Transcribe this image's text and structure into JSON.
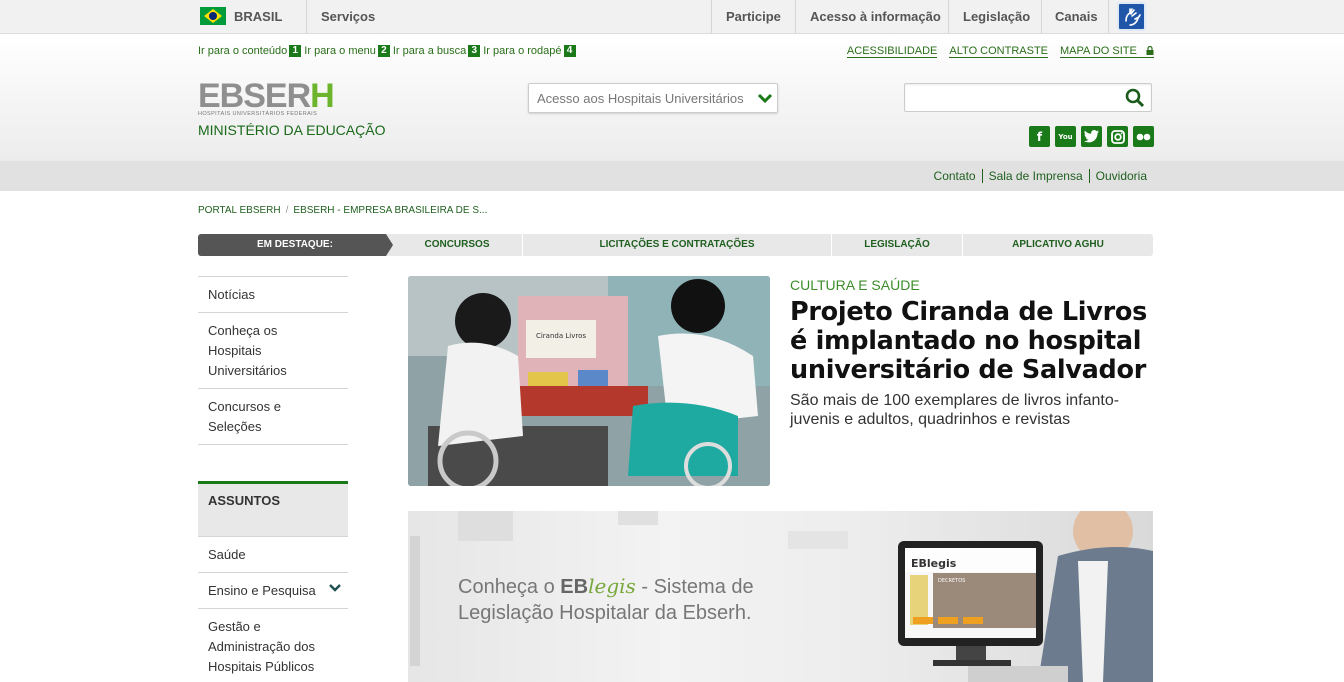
{
  "govbar": {
    "country": "BRASIL",
    "services": "Serviços",
    "links": [
      "Participe",
      "Acesso à informação",
      "Legislação",
      "Canais"
    ]
  },
  "skip_links": [
    {
      "label": "Ir para o conteúdo",
      "key": "1"
    },
    {
      "label": "Ir para o menu",
      "key": "2"
    },
    {
      "label": "Ir para a busca",
      "key": "3"
    },
    {
      "label": "Ir para o rodapé",
      "key": "4"
    }
  ],
  "accessibility_links": [
    "ACESSIBILIDADE",
    "ALTO CONTRASTE",
    "MAPA DO SITE"
  ],
  "logo": {
    "name_a": "EBSER",
    "name_b": "H",
    "subtitle": "HOSPITAIS UNIVERSITÁRIOS FEDERAIS",
    "ministry": "MINISTÉRIO DA EDUCAÇÃO"
  },
  "hospital_select": {
    "selected": "Acesso aos Hospitais Universitários"
  },
  "search": {
    "value": "",
    "placeholder": ""
  },
  "socials": [
    {
      "name": "facebook",
      "glyph": "f"
    },
    {
      "name": "youtube",
      "glyph": "You"
    },
    {
      "name": "twitter",
      "glyph": "t"
    },
    {
      "name": "instagram",
      "glyph": "◎"
    },
    {
      "name": "flickr",
      "glyph": "●●"
    }
  ],
  "service_links": [
    "Contato",
    "Sala de Imprensa",
    "Ouvidoria"
  ],
  "breadcrumb": [
    "PORTAL EBSERH",
    "EBSERH - EMPRESA BRASILEIRA DE S..."
  ],
  "highlight": {
    "label": "EM DESTAQUE:",
    "items": [
      "CONCURSOS",
      "LICITAÇÕES E CONTRATAÇÕES",
      "LEGISLAÇÃO",
      "APLICATIVO AGHU"
    ]
  },
  "sidebar": {
    "items": [
      "Notícias",
      "Conheça os Hospitais Universitários",
      "Concursos e Seleções"
    ],
    "section_title": "ASSUNTOS",
    "topics": [
      "Saúde",
      "Ensino e Pesquisa",
      "Gestão e Administração dos Hospitais Públicos"
    ]
  },
  "feature": {
    "kicker": "CULTURA E SAÚDE",
    "title": "Projeto Ciranda de Livros é implantado no hospital universitário de Salvador",
    "description": "São mais de 100 exemplares de livros infanto-juvenis e adultos, quadrinhos e revistas",
    "image_sign": "Ciranda Livros"
  },
  "banner": {
    "line1_a": "Conheça o ",
    "line1_eb": "EB",
    "line1_legis": "legis",
    "line1_b": " - Sistema de",
    "line2": "Legislação Hospitalar da Ebserh.",
    "screen_logo": "EBlegis",
    "screen_heading": "DECRETOS"
  },
  "colors": {
    "accent_green": "#1a7a1a",
    "link_green": "#2a6e1a",
    "grey_bar": "#e1e1e1"
  }
}
